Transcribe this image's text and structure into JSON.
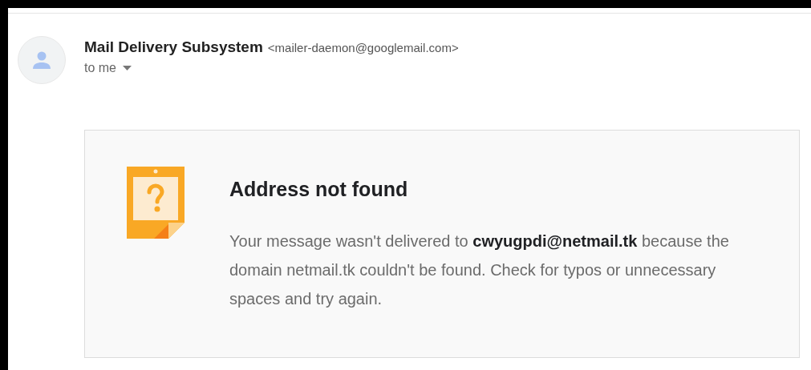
{
  "sender": {
    "name": "Mail Delivery Subsystem",
    "address": "<mailer-daemon@googlemail.com>",
    "recipient": "to me"
  },
  "notice": {
    "title": "Address not found",
    "body": "Your message wasn't delivered to **cwyugpdi@netmail.tk** because the domain netmail.tk couldn't be found. Check for typos or unnecessary spaces and try again."
  }
}
